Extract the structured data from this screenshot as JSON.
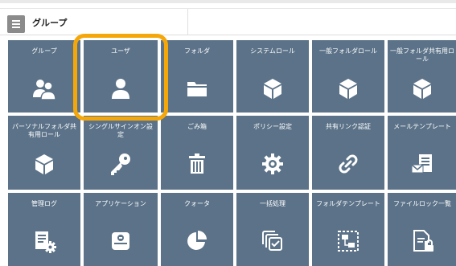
{
  "header": {
    "title": "グループ"
  },
  "tiles": [
    {
      "label": "グループ",
      "icon": "group-icon"
    },
    {
      "label": "ユーザ",
      "icon": "user-icon"
    },
    {
      "label": "フォルダ",
      "icon": "folder-icon"
    },
    {
      "label": "システムロール",
      "icon": "cube-icon"
    },
    {
      "label": "一般フォルダロール",
      "icon": "cube-icon"
    },
    {
      "label": "一般フォルダ共有用ロール",
      "icon": "cube-icon"
    },
    {
      "label": "パーソナルフォルダ共有用ロール",
      "icon": "cube-icon"
    },
    {
      "label": "シングルサインオン設定",
      "icon": "key-icon"
    },
    {
      "label": "ごみ箱",
      "icon": "trash-icon"
    },
    {
      "label": "ポリシー設定",
      "icon": "gear-icon"
    },
    {
      "label": "共有リンク認証",
      "icon": "link-icon"
    },
    {
      "label": "メールテンプレート",
      "icon": "mail-template-icon"
    },
    {
      "label": "管理ログ",
      "icon": "log-settings-icon"
    },
    {
      "label": "アプリケーション",
      "icon": "drive-icon"
    },
    {
      "label": "クォータ",
      "icon": "pie-chart-icon"
    },
    {
      "label": "一括処理",
      "icon": "batch-icon"
    },
    {
      "label": "フォルダテンプレート",
      "icon": "folder-template-icon"
    },
    {
      "label": "ファイルロック一覧",
      "icon": "file-lock-icon"
    }
  ],
  "colors": {
    "tile": "#5b7288",
    "highlight": "#f5a70a",
    "menu": "#8b8b8b"
  }
}
